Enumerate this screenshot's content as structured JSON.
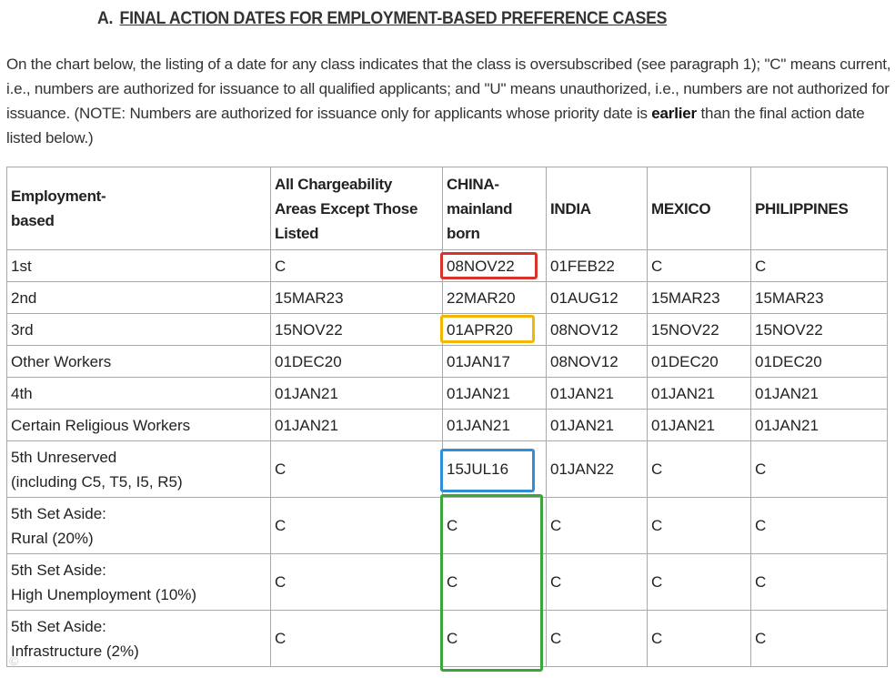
{
  "section": {
    "letter": "A.",
    "title": "FINAL ACTION DATES FOR EMPLOYMENT-BASED PREFERENCE CASES"
  },
  "intro": {
    "part1": "On the chart below, the listing of a date for any class indicates that the class is oversubscribed (see paragraph 1); \"C\" means current, i.e., numbers are authorized for issuance to all qualified applicants; and \"U\" means unauthorized, i.e., numbers are not authorized for issuance. (NOTE: Numbers are authorized for issuance only for applicants whose priority date is ",
    "emphasis": "earlier",
    "part2": " than the final action date listed below.)"
  },
  "table": {
    "headers": {
      "category": "Employment-based",
      "all": "All Chargeability Areas Except Those Listed",
      "china": "CHINA-mainland born",
      "india": "INDIA",
      "mexico": "MEXICO",
      "philippines": "PHILIPPINES"
    },
    "rows": [
      {
        "category": "1st",
        "all": "C",
        "china": "08NOV22",
        "india": "01FEB22",
        "mexico": "C",
        "philippines": "C"
      },
      {
        "category": "2nd",
        "all": "15MAR23",
        "china": "22MAR20",
        "india": "01AUG12",
        "mexico": "15MAR23",
        "philippines": "15MAR23"
      },
      {
        "category": "3rd",
        "all": "15NOV22",
        "china": "01APR20",
        "india": "08NOV12",
        "mexico": "15NOV22",
        "philippines": "15NOV22"
      },
      {
        "category": "Other Workers",
        "all": "01DEC20",
        "china": "01JAN17",
        "india": "08NOV12",
        "mexico": "01DEC20",
        "philippines": "01DEC20"
      },
      {
        "category": "4th",
        "all": "01JAN21",
        "china": "01JAN21",
        "india": "01JAN21",
        "mexico": "01JAN21",
        "philippines": "01JAN21"
      },
      {
        "category": "Certain Religious Workers",
        "all": "01JAN21",
        "china": "01JAN21",
        "india": "01JAN21",
        "mexico": "01JAN21",
        "philippines": "01JAN21"
      },
      {
        "category_line1": "5th Unreserved",
        "category_line2": "(including C5, T5, I5, R5)",
        "all": "C",
        "china": "15JUL16",
        "india": "01JAN22",
        "mexico": "C",
        "philippines": "C"
      },
      {
        "category_line1": "5th Set Aside:",
        "category_line2": "Rural (20%)",
        "all": "C",
        "china": "C",
        "india": "C",
        "mexico": "C",
        "philippines": "C"
      },
      {
        "category_line1": "5th Set Aside:",
        "category_line2": "High Unemployment (10%)",
        "all": "C",
        "china": "C",
        "india": "C",
        "mexico": "C",
        "philippines": "C"
      },
      {
        "category_line1": "5th Set Aside:",
        "category_line2": "Infrastructure (2%)",
        "all": "C",
        "china": "C",
        "india": "C",
        "mexico": "C",
        "philippines": "C"
      }
    ]
  },
  "highlights": {
    "red": "#d9342b",
    "yellow": "#f2b705",
    "blue": "#2e8fd8",
    "green": "#3aa53a"
  }
}
